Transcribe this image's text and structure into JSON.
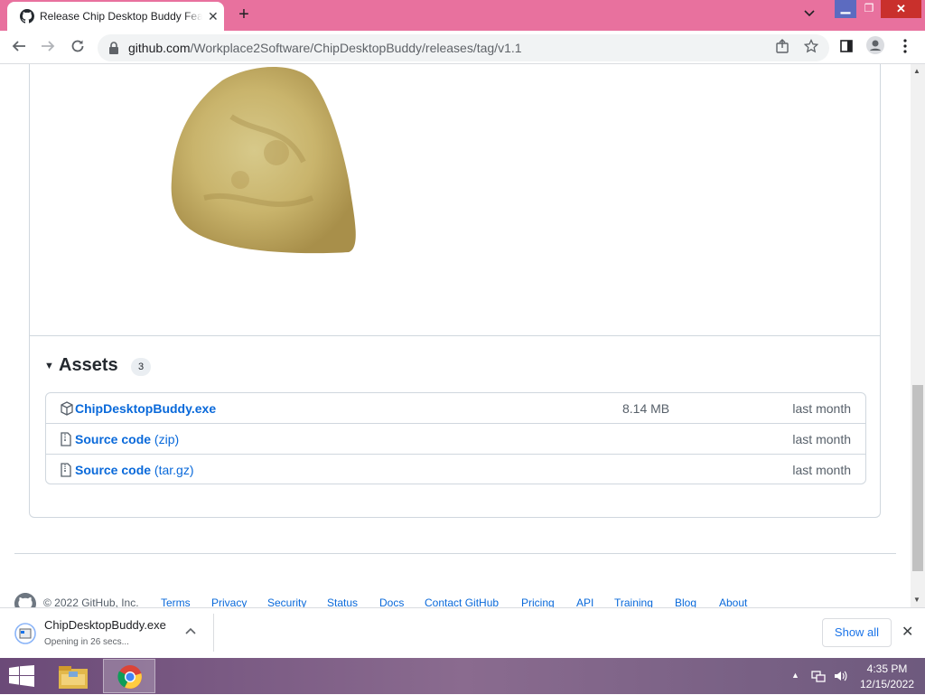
{
  "browser": {
    "tab_title": "Release Chip Desktop Buddy Feature",
    "url_host": "github.com",
    "url_path": "/Workplace2Software/ChipDesktopBuddy/releases/tag/v1.1",
    "tab_close": "✕",
    "new_tab": "+",
    "tab_menu": "⌄"
  },
  "assets": {
    "title": "Assets",
    "count": "3",
    "items": [
      {
        "name": "ChipDesktopBuddy.exe",
        "suffix": "",
        "size": "8.14 MB",
        "date": "last month",
        "icon": "package-icon"
      },
      {
        "name": "Source code",
        "suffix": " (zip)",
        "size": "",
        "date": "last month",
        "icon": "file-zip-icon"
      },
      {
        "name": "Source code",
        "suffix": " (tar.gz)",
        "size": "",
        "date": "last month",
        "icon": "file-zip-icon"
      }
    ]
  },
  "footer": {
    "copyright": "© 2022 GitHub, Inc.",
    "links": [
      "Terms",
      "Privacy",
      "Security",
      "Status",
      "Docs",
      "Contact GitHub",
      "Pricing",
      "API",
      "Training",
      "Blog",
      "About"
    ]
  },
  "download": {
    "file": "ChipDesktopBuddy.exe",
    "status": "Opening in 26 secs...",
    "show_all": "Show all"
  },
  "taskbar": {
    "time": "4:35 PM",
    "date": "12/15/2022"
  },
  "colors": {
    "titlebar": "#e8719e",
    "link": "#0969da",
    "taskbar": "#7a5a86"
  }
}
